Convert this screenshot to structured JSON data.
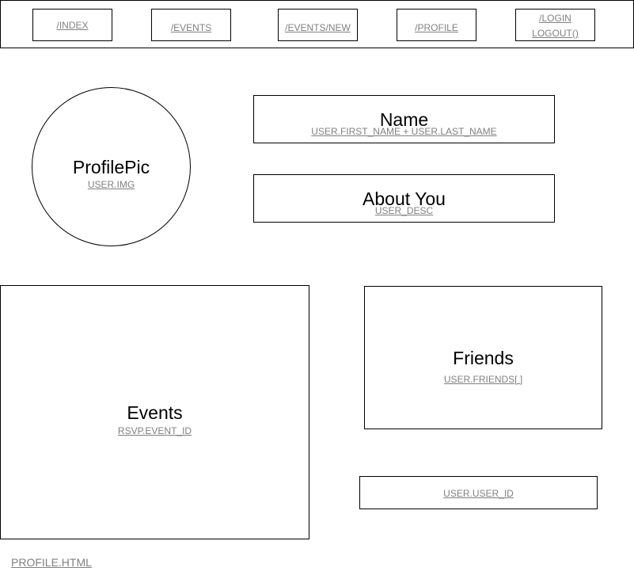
{
  "nav": {
    "index": "/INDEX",
    "events": "/EVENTS",
    "events_new": "/EVENTS/NEW",
    "profile": "/PROFILE",
    "login_line1": "/LOGIN",
    "login_line2": "LOGOUT()"
  },
  "profile_pic": {
    "title": "ProfilePic",
    "binding": "USER.IMG"
  },
  "name": {
    "title": "Name",
    "binding": "USER.FIRST_NAME + USER.LAST_NAME"
  },
  "about": {
    "title": "About You",
    "binding": "USER_DESC"
  },
  "events": {
    "title": "Events",
    "binding": "RSVP.EVENT_ID"
  },
  "friends": {
    "title": "Friends",
    "binding": "USER.FRIENDS[ ]"
  },
  "user_id": {
    "binding": "USER.USER_ID"
  },
  "page_label": "PROFILE.HTML",
  "colors": {
    "border": "#000000",
    "link_text": "#808080",
    "background": "#ffffff"
  }
}
